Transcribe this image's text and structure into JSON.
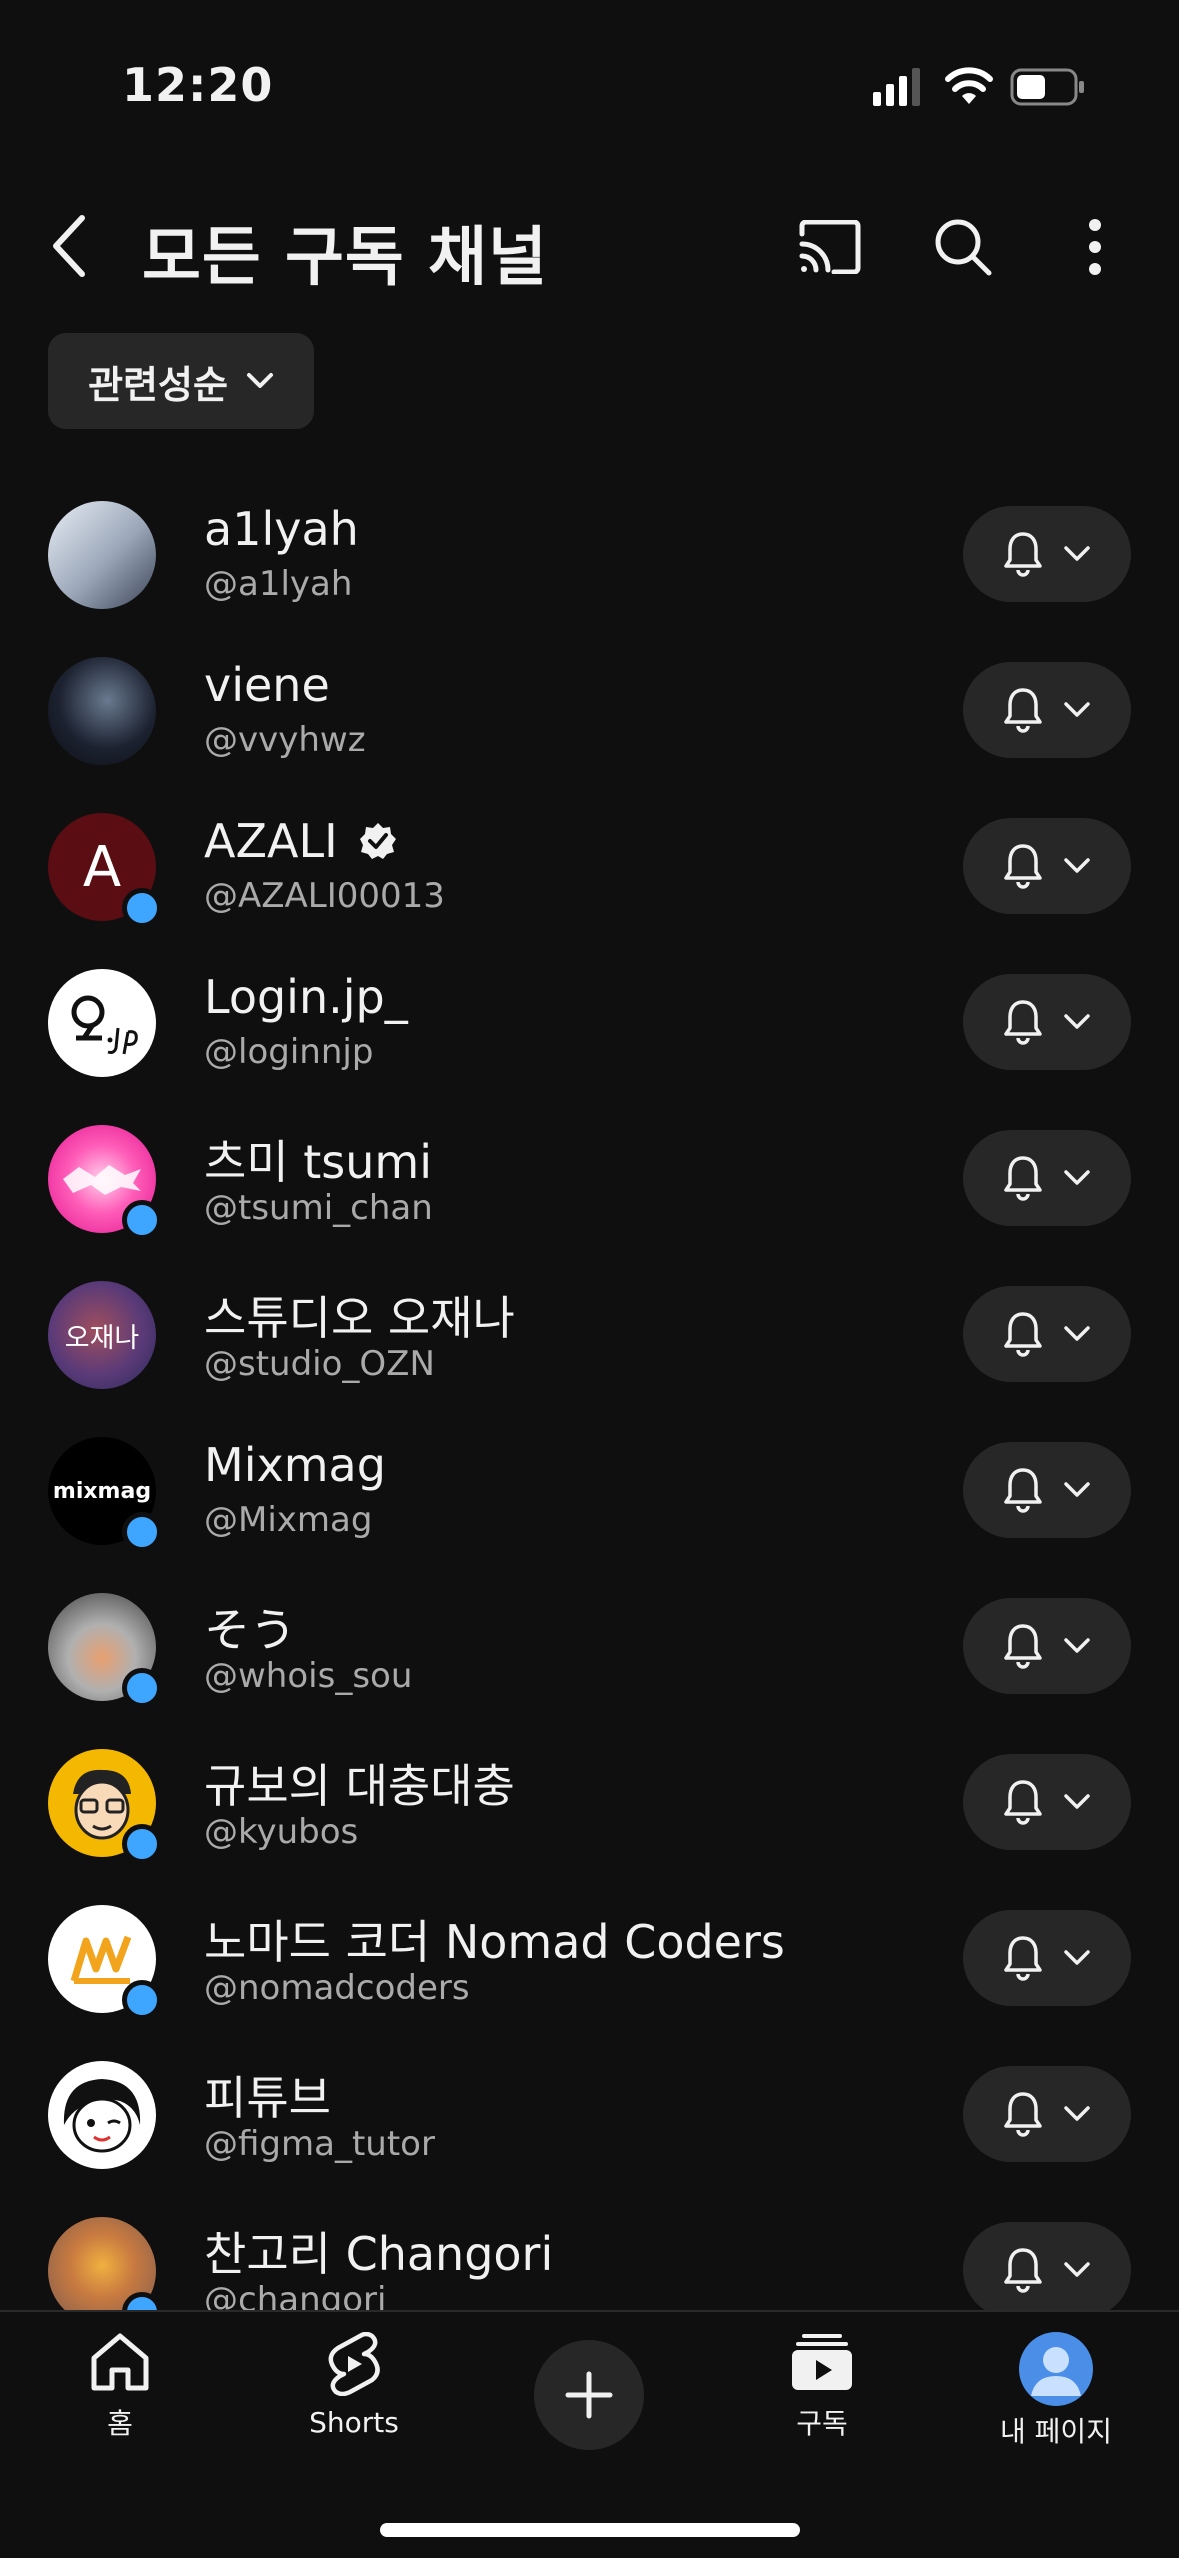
{
  "status_bar": {
    "time": "12:20"
  },
  "header": {
    "title": "모든 구독 채널"
  },
  "sort": {
    "label": "관련성순"
  },
  "channels": [
    {
      "name": "a1lyah",
      "handle": "@a1lyah"
    },
    {
      "name": "viene",
      "handle": "@vvyhwz"
    },
    {
      "name": "AZALI",
      "handle": "@AZALI00013",
      "avatar_letter": "A"
    },
    {
      "name": "Login.jp_",
      "handle": "@loginnjp"
    },
    {
      "name": "츠미 tsumi",
      "handle": "@tsumi_chan"
    },
    {
      "name": "스튜디오 오재나",
      "handle": "@studio_OZN",
      "avatar_text": "오재나"
    },
    {
      "name": "Mixmag",
      "handle": "@Mixmag",
      "avatar_text": "mixmag"
    },
    {
      "name": "そう",
      "handle": "@whois_sou"
    },
    {
      "name": "규보의 대충대충",
      "handle": "@kyubos"
    },
    {
      "name": "노마드 코더 Nomad Coders",
      "handle": "@nomadcoders"
    },
    {
      "name": "피튜브",
      "handle": "@figma_tutor"
    },
    {
      "name": "찬고리 Changori",
      "handle": "@changori"
    }
  ],
  "bottom_nav": {
    "home": "홈",
    "shorts": "Shorts",
    "subscriptions": "구독",
    "my_page": "내 페이지"
  },
  "colors": {
    "background": "#0f0f0f",
    "chip": "#272727",
    "live_dot": "#3ea6ff",
    "handle_text": "#aaaaaa"
  }
}
